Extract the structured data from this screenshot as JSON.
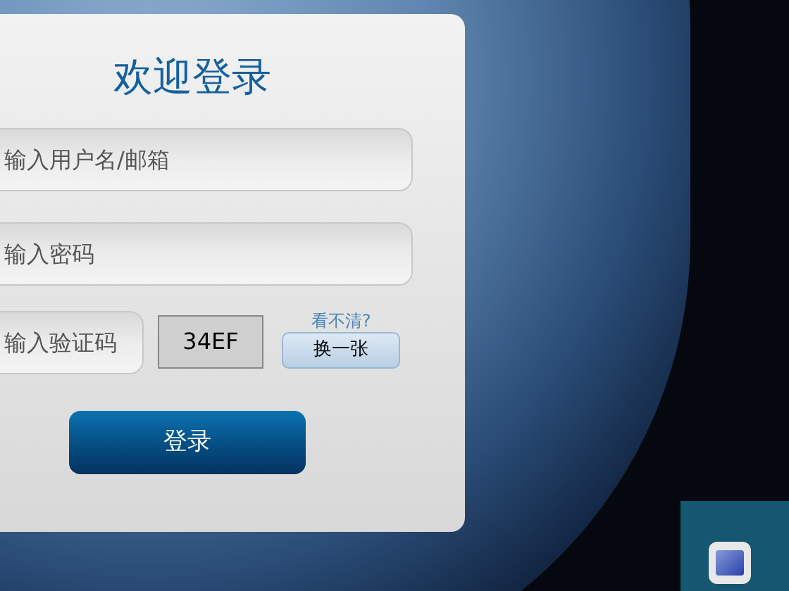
{
  "login_panel": {
    "title": "欢迎登录",
    "username_field": {
      "placeholder": "输入用户名/邮箱"
    },
    "password_field": {
      "placeholder": "输入密码"
    },
    "captcha_field": {
      "placeholder": "输入验证码"
    },
    "captcha_code": "34EF",
    "captcha_hint": "看不清?",
    "refresh_button": "换一张",
    "login_button": "登录"
  }
}
